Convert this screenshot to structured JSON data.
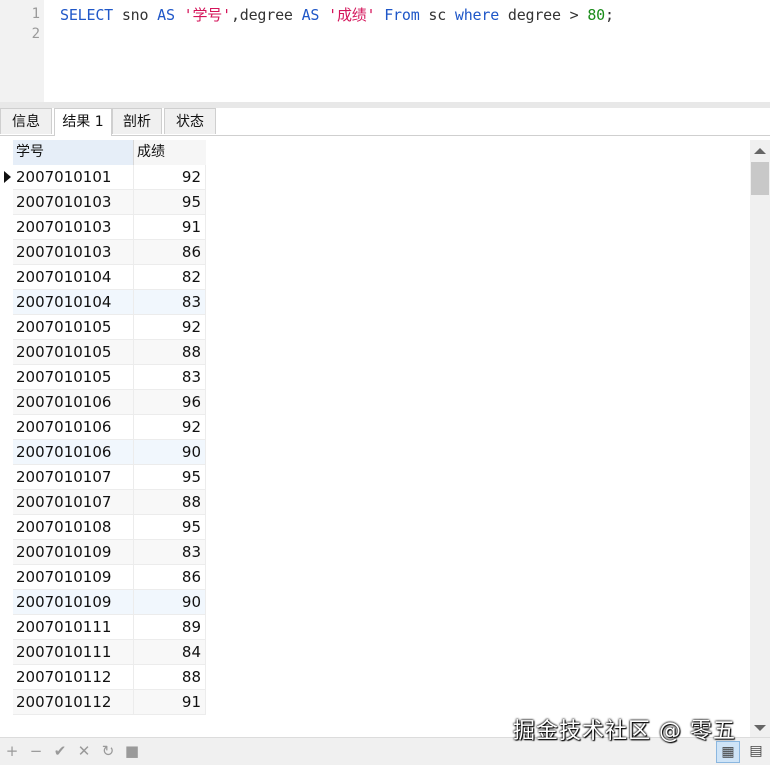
{
  "editor": {
    "line_numbers": [
      "1",
      "2"
    ],
    "tokens": [
      {
        "t": "SELECT",
        "c": "kw"
      },
      {
        "t": " sno ",
        "c": ""
      },
      {
        "t": "AS",
        "c": "kw"
      },
      {
        "t": " ",
        "c": ""
      },
      {
        "t": "'学号'",
        "c": "str"
      },
      {
        "t": ",degree ",
        "c": ""
      },
      {
        "t": "AS",
        "c": "kw"
      },
      {
        "t": " ",
        "c": ""
      },
      {
        "t": "'成绩'",
        "c": "str"
      },
      {
        "t": " ",
        "c": ""
      },
      {
        "t": "From",
        "c": "kw"
      },
      {
        "t": " sc ",
        "c": ""
      },
      {
        "t": "where",
        "c": "kw"
      },
      {
        "t": " degree > ",
        "c": ""
      },
      {
        "t": "80",
        "c": "num"
      },
      {
        "t": ";",
        "c": ""
      }
    ]
  },
  "tabs": [
    "信息",
    "结果 1",
    "剖析",
    "状态"
  ],
  "active_tab": 1,
  "grid": {
    "columns": [
      "学号",
      "成绩"
    ],
    "rows": [
      [
        "2007010101",
        "92"
      ],
      [
        "2007010103",
        "95"
      ],
      [
        "2007010103",
        "91"
      ],
      [
        "2007010103",
        "86"
      ],
      [
        "2007010104",
        "82"
      ],
      [
        "2007010104",
        "83"
      ],
      [
        "2007010105",
        "92"
      ],
      [
        "2007010105",
        "88"
      ],
      [
        "2007010105",
        "83"
      ],
      [
        "2007010106",
        "96"
      ],
      [
        "2007010106",
        "92"
      ],
      [
        "2007010106",
        "90"
      ],
      [
        "2007010107",
        "95"
      ],
      [
        "2007010107",
        "88"
      ],
      [
        "2007010108",
        "95"
      ],
      [
        "2007010109",
        "83"
      ],
      [
        "2007010109",
        "86"
      ],
      [
        "2007010109",
        "90"
      ],
      [
        "2007010111",
        "89"
      ],
      [
        "2007010111",
        "84"
      ],
      [
        "2007010112",
        "88"
      ],
      [
        "2007010112",
        "91"
      ]
    ],
    "current_row": 0
  },
  "toolbar": {
    "buttons": [
      {
        "name": "add-record-button",
        "glyph": "+"
      },
      {
        "name": "delete-record-button",
        "glyph": "−"
      },
      {
        "name": "apply-changes-button",
        "glyph": "✔"
      },
      {
        "name": "discard-changes-button",
        "glyph": "✕"
      },
      {
        "name": "refresh-button",
        "glyph": "↻"
      },
      {
        "name": "stop-button",
        "glyph": "■"
      }
    ],
    "views": [
      {
        "name": "grid-view-button",
        "icon": "grid-icon",
        "glyph": "▦"
      },
      {
        "name": "form-view-button",
        "icon": "form-icon",
        "glyph": "▤"
      }
    ]
  },
  "watermark": "掘金技术社区 @ 零五",
  "colors": {
    "keyword": "#1f57c8",
    "string": "#d4145a",
    "number": "#1a8c1a"
  }
}
